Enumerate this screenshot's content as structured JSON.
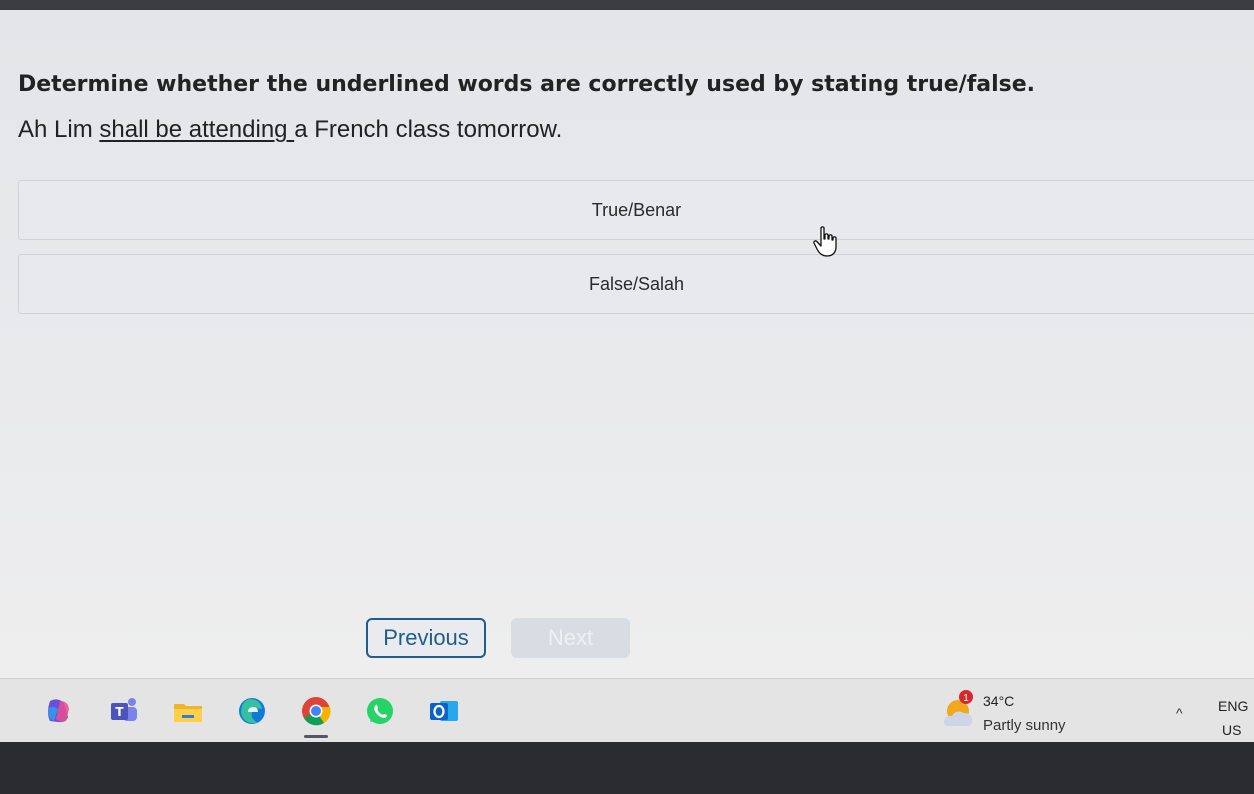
{
  "quiz": {
    "instruction": "Determine whether the underlined words are correctly used by stating true/false.",
    "sentence_before": "Ah Lim ",
    "sentence_underlined": "shall be attending ",
    "sentence_after": "a French class tomorrow.",
    "options": [
      {
        "label": "True/Benar"
      },
      {
        "label": "False/Salah"
      }
    ],
    "previous_label": "Previous",
    "next_label": "Next"
  },
  "taskbar": {
    "icons": [
      "copilot-icon",
      "teams-icon",
      "file-explorer-icon",
      "edge-icon",
      "chrome-icon",
      "whatsapp-icon",
      "outlook-icon"
    ],
    "weather": {
      "badge": "1",
      "temperature": "34°C",
      "condition": "Partly sunny"
    },
    "tray_chevron": "^",
    "language": "ENG",
    "region": "US"
  },
  "colors": {
    "accent": "#1f5d8c",
    "next_disabled_bg": "#d7dde3",
    "weather_badge": "#d9272e"
  }
}
